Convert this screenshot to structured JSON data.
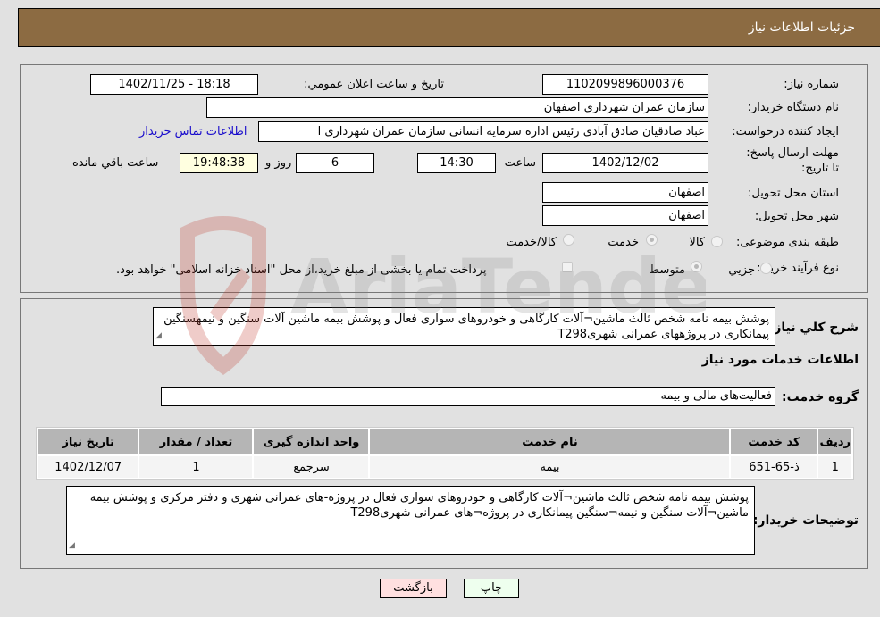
{
  "header": {
    "title": "جزئیات اطلاعات نیاز"
  },
  "details": {
    "need_number_label": "شماره نیاز:",
    "need_number": "1102099896000376",
    "announce_label": "تاريخ و ساعت اعلان عمومي:",
    "announce_value": "1402/11/25 - 18:18",
    "buyer_org_label": "نام دستگاه خریدار:",
    "buyer_org": "سازمان عمران شهرداری اصفهان",
    "creator_label": "ایجاد کننده درخواست:",
    "creator": "عباد صادقیان صادق آبادی رئیس اداره سرمایه انسانی سازمان عمران شهرداری ا",
    "contact_link": "اطلاعات تماس خریدار",
    "deadline_label": "مهلت ارسال پاسخ: تا تاریخ:",
    "deadline_date": "1402/12/02",
    "time_label": "ساعت",
    "deadline_time": "14:30",
    "days_value": "6",
    "days_label": "روز و",
    "remaining_time": "19:48:38",
    "remaining_label": "ساعت باقي مانده",
    "province_label": "استان محل تحویل:",
    "province": "اصفهان",
    "city_label": "شهر محل تحویل:",
    "city": "اصفهان",
    "category_label": "طبقه بندی موضوعی:",
    "category_options": [
      {
        "label": "کالا",
        "checked": false
      },
      {
        "label": "خدمت",
        "checked": true
      },
      {
        "label": "کالا/خدمت",
        "checked": false
      }
    ],
    "process_label": "نوع فرآیند خرید :",
    "process_options": [
      {
        "label": "جزيي",
        "checked": false
      },
      {
        "label": "متوسط",
        "checked": true
      }
    ],
    "treasury_note": "پرداخت تمام یا بخشی از مبلغ خرید،از محل \"اسناد خزانه اسلامی\" خواهد بود."
  },
  "description": {
    "label": "شرح کلي نياز:",
    "value": "پوشش بیمه نامه شخص ثالث ماشین¬آلات کارگاهی  و خودروهای سواری فعال و  پوشش بیمه ماشین آلات سنگین و نیمهسنگین پیمانکاری در پروژههای عمرانی شهریT298"
  },
  "services": {
    "section_title": "اطلاعات خدمات مورد نياز",
    "group_label": "گروه خدمت:",
    "group_value": "فعالیت‌های مالی و بیمه",
    "columns": [
      "ردیف",
      "کد خدمت",
      "نام خدمت",
      "واحد اندازه گیری",
      "تعداد / مقدار",
      "تاریخ نیاز"
    ],
    "rows": [
      [
        "1",
        "ذ-65-651",
        "بیمه",
        "سرجمع",
        "1",
        "1402/12/07"
      ]
    ]
  },
  "buyer_notes": {
    "label": "توضیحات خریدار:",
    "value": "پوشش بیمه نامه شخص ثالث ماشین¬آلات کارگاهی  و خودروهای سواری فعال در پروژه-های عمرانی شهری و دفتر مرکزی و  پوشش بیمه ماشین¬آلات سنگین و نیمه¬سنگین پیمانکاری در پروژه¬های عمرانی شهریT298"
  },
  "buttons": {
    "print": "چاپ",
    "back": "بازگشت"
  },
  "colors": {
    "header_bg": "#8c6b42",
    "print_bg": "#eeffee",
    "back_bg": "#ffe0e0",
    "link": "#1a0dcc"
  },
  "watermark": {
    "text": "AriaTender.neT"
  }
}
